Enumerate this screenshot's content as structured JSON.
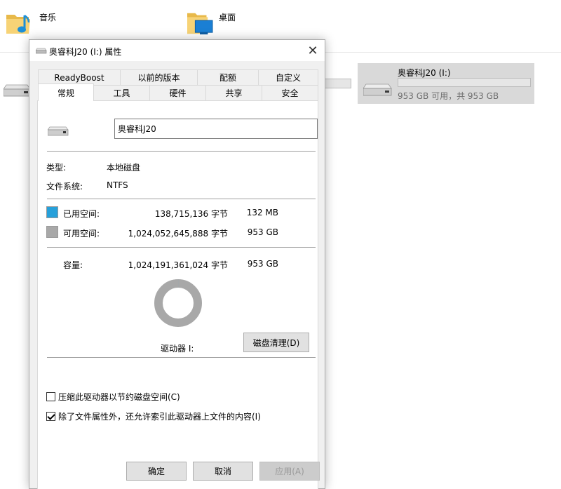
{
  "explorer": {
    "items": [
      {
        "label": "音乐"
      },
      {
        "label": "桌面"
      }
    ],
    "drive_tile": {
      "name": "奥睿科J20 (I:)",
      "subtitle": "953 GB 可用，共 953 GB",
      "used_fraction": 0.0
    }
  },
  "dialog": {
    "title": "奥睿科J20 (I:) 属性",
    "close_label": "✕",
    "tabs_row1": [
      "ReadyBoost",
      "以前的版本",
      "配额",
      "自定义"
    ],
    "tabs_row2": [
      "常规",
      "工具",
      "硬件",
      "共享",
      "安全"
    ],
    "active_tab": "常规",
    "general": {
      "drive_name_value": "奥睿科J20",
      "type_label": "类型:",
      "type_value": "本地磁盘",
      "fs_label": "文件系统:",
      "fs_value": "NTFS",
      "used": {
        "label": "已用空间:",
        "bytes": "138,715,136 字节",
        "size": "132 MB",
        "color": "#26a0da"
      },
      "free": {
        "label": "可用空间:",
        "bytes": "1,024,052,645,888 字节",
        "size": "953 GB",
        "color": "#a8a8a8"
      },
      "capacity": {
        "label": "容量:",
        "bytes": "1,024,191,361,024 字节",
        "size": "953 GB"
      },
      "drive_label": "驱动器 I:",
      "cleanup_button": "磁盘清理(D)",
      "compress_option": {
        "label": "压缩此驱动器以节约磁盘空间(C)",
        "checked": false
      },
      "index_option": {
        "label": "除了文件属性外，还允许索引此驱动器上文件的内容(I)",
        "checked": true
      }
    },
    "buttons": {
      "ok": "确定",
      "cancel": "取消",
      "apply": "应用(A)"
    }
  }
}
